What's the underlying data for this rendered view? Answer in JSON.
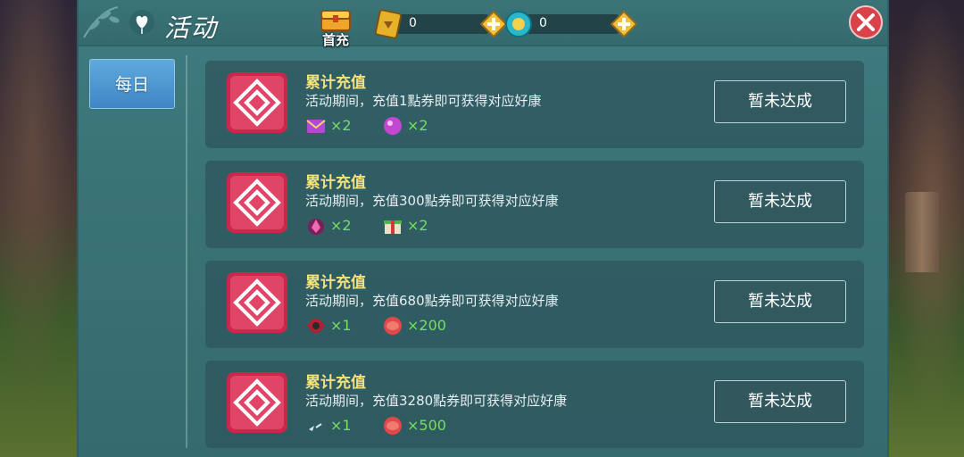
{
  "header": {
    "title": "活动",
    "first_charge_label": "首充",
    "currencies": [
      {
        "name": "coupon",
        "icon": "gold-coupon-icon",
        "value": "0"
      },
      {
        "name": "diamond",
        "icon": "blue-gem-icon",
        "value": "0"
      }
    ]
  },
  "sidebar": {
    "tabs": [
      {
        "label": "每日",
        "active": true
      }
    ]
  },
  "activities": [
    {
      "name": "累计充值",
      "desc": "活动期间，充值1點券即可获得对应好康",
      "rewards": [
        {
          "icon": "purple-envelope-icon",
          "qty": "×2"
        },
        {
          "icon": "purple-orb-icon",
          "qty": "×2"
        }
      ],
      "status": "暂未达成"
    },
    {
      "name": "累计充值",
      "desc": "活动期间，充值300點券即可获得对应好康",
      "rewards": [
        {
          "icon": "pink-crystal-icon",
          "qty": "×2"
        },
        {
          "icon": "gift-box-icon",
          "qty": "×2"
        }
      ],
      "status": "暂未达成"
    },
    {
      "name": "累计充值",
      "desc": "活动期间，充值680點券即可获得对应好康",
      "rewards": [
        {
          "icon": "red-amulet-icon",
          "qty": "×1"
        },
        {
          "icon": "red-orb-icon",
          "qty": "×200"
        }
      ],
      "status": "暂未达成"
    },
    {
      "name": "累计充值",
      "desc": "活动期间，充值3280點券即可获得对应好康",
      "rewards": [
        {
          "icon": "sparkle-icon",
          "qty": "×1"
        },
        {
          "icon": "red-orb-icon",
          "qty": "×500"
        }
      ],
      "status": "暂未达成"
    }
  ],
  "colors": {
    "panel": "#3a7376",
    "title_gold": "#f3e37a",
    "reward_green": "#74e05b",
    "tab_blue": "#3f86c4",
    "close_red": "#d8434a"
  }
}
